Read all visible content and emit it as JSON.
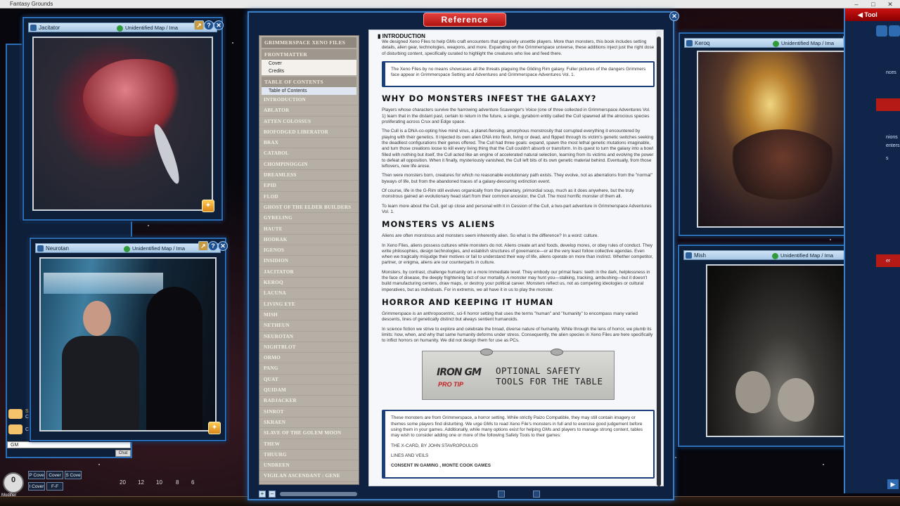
{
  "app": {
    "title": "Fantasy Grounds"
  },
  "windows": {
    "jacitator": {
      "title": "Jacitator",
      "id_label": "Unidentified Map / Ima"
    },
    "neurotan": {
      "title": "Neurotan",
      "id_label": "Unidentified Map / Ima"
    },
    "keroq": {
      "title": "Keroq",
      "id_label": "Unidentified Map / Ima"
    },
    "mish": {
      "title": "Mish",
      "id_label": "Unidentified Map / Ima"
    }
  },
  "reference": {
    "title": "Reference",
    "toc": {
      "header": "Grimmerspace Xeno Files",
      "frontmatter": "Frontmatter",
      "frontmatter_items": [
        "Cover",
        "Credits"
      ],
      "toc_section": "Table of Contents",
      "toc_items": [
        "Table of Contents"
      ],
      "entries": [
        "Introduction",
        "Ablator",
        "Atten Colossus",
        "Biofodged Liberator",
        "Brax",
        "Catabol",
        "Chompinoggin",
        "Dreamless",
        "Epid",
        "Flod",
        "Ghost of the Elder Builders",
        "Gyreling",
        "Haute",
        "Hodrak",
        "Igenos",
        "Insidion",
        "Jacitator",
        "Keroq",
        "Lacuna",
        "Living Eye",
        "Mish",
        "Netheun",
        "Neurotan",
        "Nightblot",
        "Ormo",
        "Pang",
        "Quat",
        "Quidam",
        "Radjacker",
        "Sinrot",
        "Skraen",
        "Slave of the Golem Moon",
        "Thew",
        "Thuurg",
        "Undreen",
        "Vigilan Ascendant : Gene"
      ]
    },
    "doc": {
      "section_title": "INTRODUCTION",
      "intro": "We designed Xeno Files to help GMs craft encounters that genuinely unsettle players. More than monsters, this book includes setting details, alien gear, technologies, weapons, and more. Expanding on the Grimmerspace universe, these additions inject just the right dose of disturbing content, specifically curated to highlight the creatures who live and feed there.",
      "callout": "The Xeno Files by no means showcases all the threats plaguing the Gliding Rim galaxy. Fuller pictures of the dangers Grimmers face appear in Grimmerspace Setting and Adventures and Grimmerspace Adventures Vol. 1.",
      "h1": "WHY DO MONSTERS INFEST THE GALAXY?",
      "p1": "Players whose characters survive the harrowing adventure Scavenger's Voice (one of three collected in Grimmerspace Adventures Vol. 1) learn that in the distant past, certain to return in the future, a single, gyraborn entity called the Cull spawned all the atrocious species proliferating across Crux and Edge space.",
      "p2": "The Cull is a DNA-co-opting hive mind virus, a planet-flensing, amorphous monstrosity that corrupted everything it encountered by playing with their genetics. It injected its own alien DNA into flesh, living or dead, and flipped through its victim's genetic switches seeking the deadliest configurations their genes offered. The Cull had three goals: expand, spawn the most lethal genetic mutations imaginable, and turn those creations loose to kill every living thing that the Cull couldn't absorb or transform. In its quest to turn the galaxy into a bowl filled with nothing but itself, the Cull acted like an engine of accelerated natural selection, learning from its victims and evolving the power to defeat all opposition. When it finally, mysteriously vanished, the Cull left bits of its own genetic material behind. Eventually, from those leftovers, new life arose.",
      "p3": "Then were monsters born, creatures for which no reasonable evolutionary path exists. They evolve, not as aberrations from the \"normal\" byways of life, but from the abandoned traces of a galaxy-devouring extinction event.",
      "p4": "Of course, life in the G-Rim still evolves organically from the planetary, primordial soup, much as it does anywhere, but the truly monstrous gained an evolutionary head start from their common ancestor, the Cull. The most horrific monster of them all.",
      "p5": "To learn more about the Cull, get up close and personal with it in Cession of the Cull, a two-part adventure in Grimmerspace Adventures Vol. 1.",
      "h2": "MONSTERS VS ALIENS",
      "p6": "Aliens are often monstrous and monsters seem inherently alien. So what is the difference? In a word: culture.",
      "p7": "In Xeno Files, aliens possess cultures while monsters do not. Aliens create art and foods, develop mores, or obey rules of conduct. They write philosophies, design technologies, and establish structures of governance—or at the very least follow collective agendas. Even when we tragically misjudge their motives or fail to understand their way of life, aliens operate on more than instinct. Whether competitor, partner, or enigma, aliens are our counterparts in culture.",
      "p8": "Monsters, by contrast, challenge humanity on a more immediate level. They embody our primal fears: teeth in the dark, helplessness in the face of disease, the deeply frightening fact of our mortality. A monster may hunt you—stalking, tracking, ambushing—but it doesn't build manufacturing centers, draw maps, or destroy your political career. Monsters reflect us, not as competing ideologies or cultural imperatives, but as individuals. For in extremis, we all have it in us to play the monster.",
      "h3": "HORROR AND KEEPING IT HUMAN",
      "p9": "Grimmerspace is an anthropocentric, sci-fi horror setting that uses the terms \"human\" and \"humanity\" to encompass many varied descents, lines of genetically distinct but always sentient humanoids.",
      "p10": "In science fiction we strive to explore and celebrate the broad, diverse nature of humanity. While through the lens of horror, we plumb its limits: how, when, and why that same humanity deforms under stress. Consequently, the alien species in Xeno Files are here specifically to inflict horrors on humanity. We did not design them for use as PCs.",
      "tip_logo": "IRON GM",
      "tip_sub": "PRO TIP",
      "tip_title_1": "OPTIONAL SAFETY",
      "tip_title_2": "TOOLS FOR THE TABLE",
      "safety_p": "These monsters are from Grimmerspace, a horror setting. While strictly Paizo Compatible, they may still contain imagery or themes some players find disturbing. We urge GMs to read Xeno File's monsters in full and to exercise good judgement before using them in your games. Additionally, while many options exist for helping GMs and players to manage strong content, tables may wish to consider adding one or more of the following Safety Tools to their games:",
      "safety_1": "THE X-CARD, BY JOHN STAVROPOULOS",
      "safety_2": "LINES AND VEILS",
      "safety_3": "CONSENT IN GAMING , MONTE COOK GAMES"
    }
  },
  "tools": {
    "title": "Tool",
    "items": [
      "nces",
      "nions",
      "enters",
      "s",
      "er"
    ]
  },
  "chat": {
    "input": "GM",
    "lines": [
      "SRI",
      "Cop",
      "Cop"
    ]
  },
  "dice": {
    "modifier_value": "0",
    "modifier_label": "Modifier",
    "buttons": [
      "P Cove",
      "Cover",
      "S Cove",
      "I Cover",
      "F-F"
    ],
    "die_labels": [
      "20",
      "12",
      "10",
      "8",
      "6"
    ]
  },
  "colors": {
    "accent": "#3b7fc7",
    "title_red": "#c11a17",
    "toc_bg": "#b5afa6"
  }
}
